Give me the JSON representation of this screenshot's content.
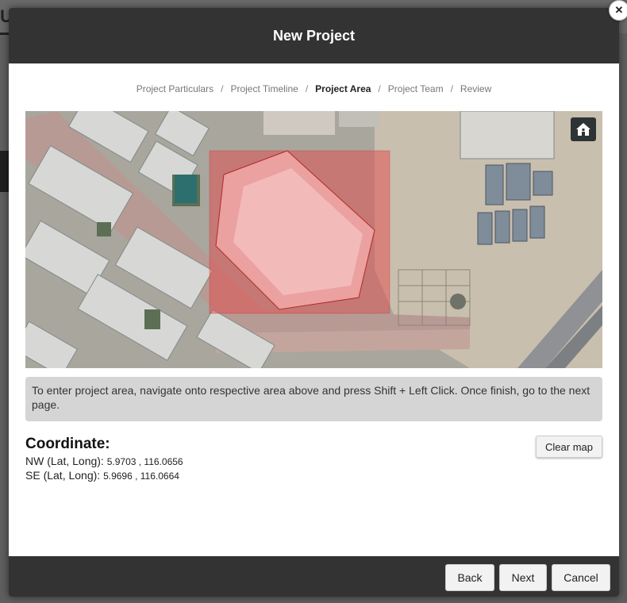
{
  "modal": {
    "title": "New Project",
    "close_icon": "close-icon"
  },
  "steps": [
    {
      "label": "Project Particulars",
      "active": false
    },
    {
      "label": "Project Timeline",
      "active": false
    },
    {
      "label": "Project Area",
      "active": true
    },
    {
      "label": "Project Team",
      "active": false
    },
    {
      "label": "Review",
      "active": false
    }
  ],
  "step_separator": "/",
  "map": {
    "home_icon": "home-icon",
    "selection_color": "#d62c2c"
  },
  "info_text": "To enter project area, navigate onto respective area above and press Shift + Left Click. Once finish, go to the next page.",
  "coordinate": {
    "title": "Coordinate:",
    "nw_label": "NW (Lat, Long):",
    "nw_value": "5.9703 , 116.0656",
    "se_label": "SE (Lat, Long):",
    "se_value": "5.9696 , 116.0664"
  },
  "buttons": {
    "clear_map": "Clear map",
    "back": "Back",
    "next": "Next",
    "cancel": "Cancel"
  },
  "colors": {
    "header_bg": "#333333",
    "info_bg": "#d5d5d5"
  }
}
